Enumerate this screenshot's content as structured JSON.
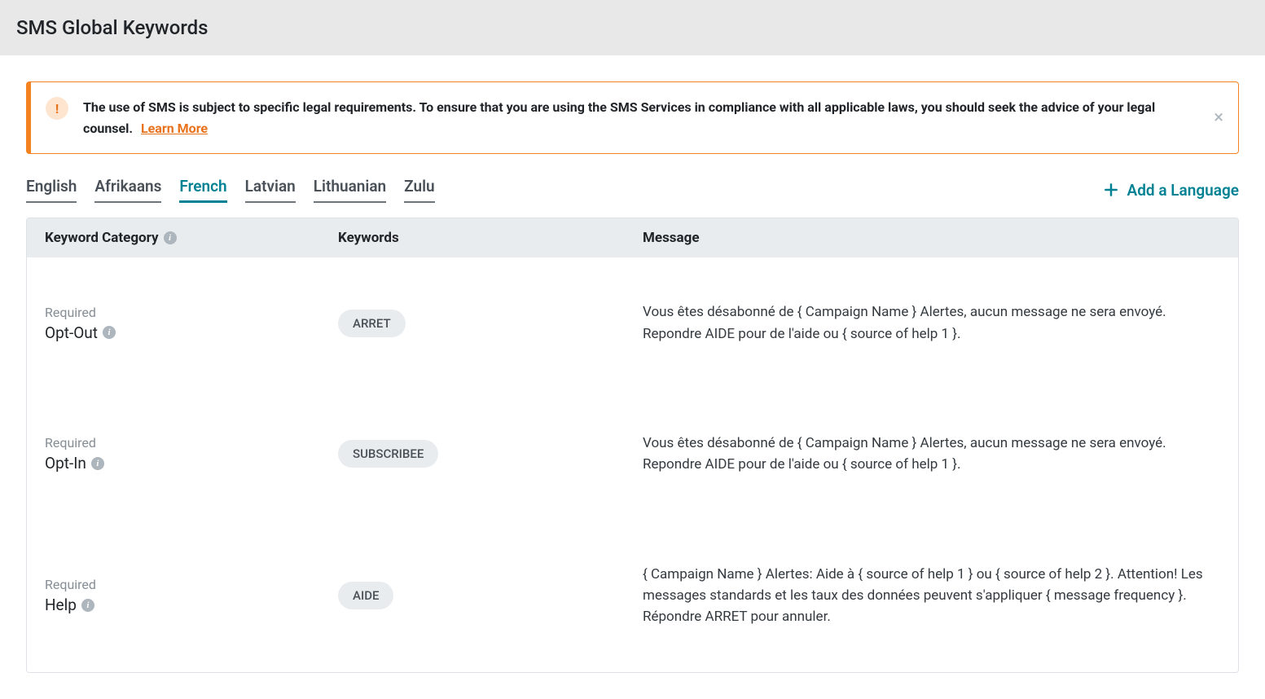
{
  "header": {
    "title": "SMS Global Keywords"
  },
  "alert": {
    "text": "The use of SMS is subject to specific legal requirements. To ensure that you are using the SMS Services in compliance with all applicable laws, you should seek the advice of your legal counsel.",
    "learn_more": "Learn More"
  },
  "tabs": {
    "items": [
      {
        "label": "English",
        "active": false
      },
      {
        "label": "Afrikaans",
        "active": false
      },
      {
        "label": "French",
        "active": true
      },
      {
        "label": "Latvian",
        "active": false
      },
      {
        "label": "Lithuanian",
        "active": false
      },
      {
        "label": "Zulu",
        "active": false
      }
    ],
    "add_label": "Add a Language"
  },
  "table": {
    "headers": {
      "category": "Keyword Category",
      "keywords": "Keywords",
      "message": "Message"
    },
    "rows": [
      {
        "required": "Required",
        "category": "Opt-Out",
        "keyword": "ARRET",
        "message": "Vous êtes désabonné de { Campaign Name } Alertes, aucun message ne sera envoyé. Repondre AIDE pour de l'aide ou { source of help 1 }."
      },
      {
        "required": "Required",
        "category": "Opt-In",
        "keyword": "SUBSCRIBEE",
        "message": "Vous êtes désabonné de { Campaign Name } Alertes, aucun message ne sera envoyé. Repondre AIDE pour de l'aide ou { source of help 1 }."
      },
      {
        "required": "Required",
        "category": "Help",
        "keyword": "AIDE",
        "message": "{ Campaign Name } Alertes: Aide à { source of help 1 } ou { source of help 2 }. Attention! Les messages standards et les taux des données peuvent s'appliquer { message frequency }. Répondre ARRET pour annuler."
      }
    ]
  }
}
